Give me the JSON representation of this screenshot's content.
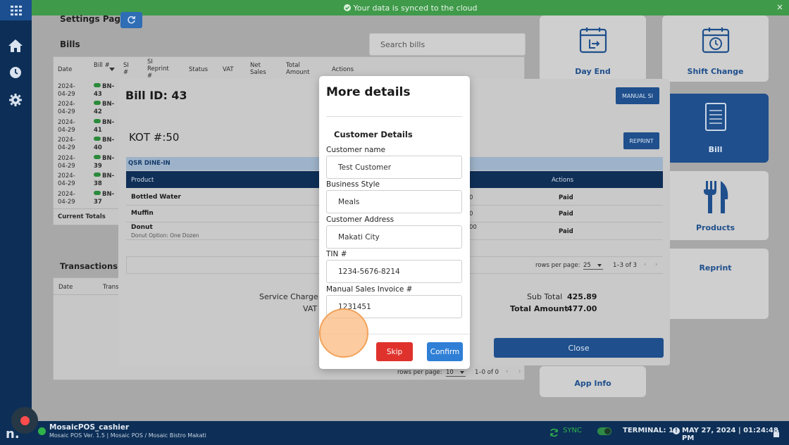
{
  "banner": {
    "message": "Your data is synced to the cloud",
    "close": "×"
  },
  "sidebar": {
    "items": [
      "home",
      "history",
      "settings"
    ]
  },
  "settings": {
    "title": "Settings Page"
  },
  "bills": {
    "title": "Bills",
    "search_placeholder": "Search bills",
    "columns": [
      "Date",
      "Bill #",
      "SI #",
      "SI Reprint #",
      "Status",
      "VAT",
      "Net Sales",
      "Total Amount",
      "Actions"
    ],
    "rows": [
      {
        "date1": "2024-",
        "date2": "04-29",
        "bn1": "BN-",
        "bn2": "43"
      },
      {
        "date1": "2024-",
        "date2": "04-29",
        "bn1": "BN-",
        "bn2": "42"
      },
      {
        "date1": "2024-",
        "date2": "04-29",
        "bn1": "BN-",
        "bn2": "41"
      },
      {
        "date1": "2024-",
        "date2": "04-29",
        "bn1": "BN-",
        "bn2": "40"
      },
      {
        "date1": "2024-",
        "date2": "04-29",
        "bn1": "BN-",
        "bn2": "39"
      },
      {
        "date1": "2024-",
        "date2": "04-29",
        "bn1": "BN-",
        "bn2": "38"
      },
      {
        "date1": "2024-",
        "date2": "04-29",
        "bn1": "BN-",
        "bn2": "37"
      }
    ],
    "current_totals": "Current Totals"
  },
  "transactions": {
    "title": "Transactions",
    "columns": [
      "Date",
      "Trans"
    ],
    "rows_per_page_label": "rows per page:",
    "rows_per_page": "10",
    "range": "1–0 of 0"
  },
  "tiles": {
    "day_end": "Day End",
    "shift_change": "Shift Change",
    "bill": "Bill",
    "products": "Products",
    "reprint": "Reprint",
    "app_info": "App Info"
  },
  "bill_modal": {
    "bill_id": "Bill ID: 43",
    "manual_si": "MANUAL SI",
    "kot": "KOT #:50",
    "reprint": "REPRINT",
    "order_type": "QSR DINE-IN",
    "col_product": "Product",
    "col_actions": "Actions",
    "products": [
      {
        "name": "Bottled Water",
        "option": "",
        "status": "Paid",
        "frag": "0"
      },
      {
        "name": "Muffin",
        "option": "",
        "status": "Paid",
        "frag": "0"
      },
      {
        "name": "Donut",
        "option": "Donut Option: One Dozen",
        "status": "Paid",
        "frag": "00"
      }
    ],
    "rows_per_page_label": "rows per page:",
    "rows_per_page": "25",
    "range": "1–3 of 3",
    "service_charge_label": "Service Charge",
    "vat_label": "VAT",
    "subtotal_label": "Sub Total",
    "subtotal_value": "425.89",
    "total_label": "Total Amount",
    "total_value": "477.00",
    "close": "Close"
  },
  "details_modal": {
    "title": "More details",
    "section": "Customer Details",
    "fields": {
      "customer_name": {
        "label": "Customer name",
        "value": "Test Customer"
      },
      "business_style": {
        "label": "Business Style",
        "value": "Meals"
      },
      "customer_address": {
        "label": "Customer Address",
        "value": "Makati City"
      },
      "tin": {
        "label": "TIN #",
        "value": "1234-5676-8214"
      },
      "manual_si": {
        "label": "Manual Sales Invoice #",
        "value": "1231451"
      }
    },
    "skip": "Skip",
    "confirm": "Confirm"
  },
  "bottom_bar": {
    "user": "MosaicPOS_cashier",
    "version": "Mosaic POS Ver. 1.5 | Mosaic POS / Mosaic Bistro Makati",
    "sync": "SYNC",
    "terminal": "TERMINAL: 1",
    "datetime": "MAY 27, 2024 | 01:24:48 PM"
  },
  "colors": {
    "primary": "#1f4f8c",
    "sidebar": "#0d2f57",
    "banner": "#3f9a4a",
    "skip": "#e0322c",
    "confirm": "#2f7fd6"
  }
}
